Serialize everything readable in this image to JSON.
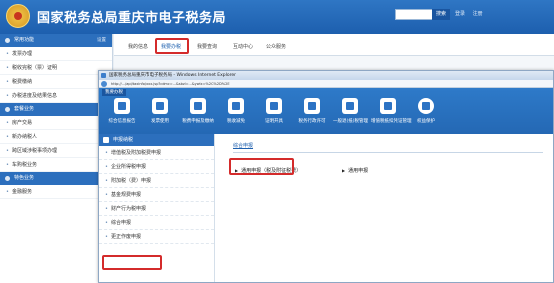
{
  "header": {
    "title": "国家税务总局重庆市电子税务局",
    "search_button": "搜索",
    "top_links": [
      "登录",
      "注册"
    ]
  },
  "sidebar": {
    "sections": [
      {
        "title": "常用功能",
        "more": "设置",
        "items": [
          "发票办理",
          "税收完税（票）证明",
          "税费缴纳",
          "办税进度及结果信息"
        ]
      },
      {
        "title": "套餐业务",
        "items": [
          "房产交易",
          "新办纳税人",
          "跨区域涉税事项办理",
          "车购税业务"
        ]
      },
      {
        "title": "特色业务",
        "items": [
          "金融服务"
        ]
      }
    ]
  },
  "main_tabs": [
    "我的信息",
    "我要办税",
    "我要查询",
    "互动中心",
    "公众服务"
  ],
  "ie": {
    "title": "国家税务总局重庆市电子税务局 - Windows Internet Explorer",
    "address": "http://.../api/taxinfo/xxx.jsp?cdmc=...&sbzl=...&ywlx=%2C%2D%2E"
  },
  "app": {
    "label": "我要办税",
    "tools": [
      "综合信息报告",
      "发票使用",
      "税费申报及缴纳",
      "税收减免",
      "证明开具",
      "税务行政许可",
      "一般退(抵)税管理",
      "增值税抵扣凭证管理",
      "权益保护"
    ]
  },
  "inner_nav": {
    "title": "申报纳税",
    "items": [
      "增值税及附加税费申报",
      "企业所得税申报",
      "附加税（费）申报",
      "基金规费申报",
      "财产行为税申报",
      "综合申报",
      "更正作废申报"
    ]
  },
  "content": {
    "title": "综合申报",
    "options": [
      "通用申报（税及附征税费）",
      "通用申报"
    ]
  },
  "colors": {
    "brand": "#1d5fae",
    "highlight": "#d42b2b"
  }
}
